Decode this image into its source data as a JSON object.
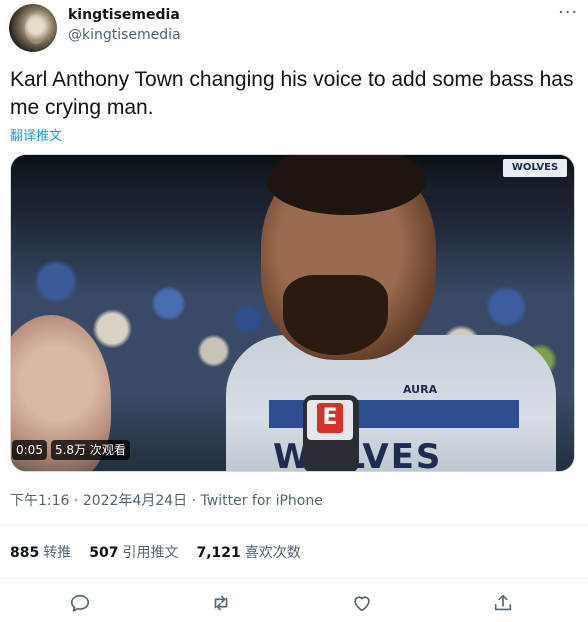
{
  "user": {
    "display_name": "kingtisemedia",
    "handle": "@kingtisemedia"
  },
  "more_label": "···",
  "tweet": {
    "text": "Karl Anthony Town changing his voice to add some bass has me crying man.",
    "translate_label": "翻译推文"
  },
  "media": {
    "duration": "0:05",
    "views": "5.8万 次观看",
    "sign_text": "WOLVES",
    "jersey_text": "WOLVES",
    "jersey_brand": "AURA",
    "mic_logo": "E"
  },
  "meta": {
    "time": "下午1:16",
    "separator": " · ",
    "date": "2022年4月24日",
    "source": "Twitter for iPhone"
  },
  "stats": {
    "retweets_count": "885",
    "retweets_label": "转推",
    "quotes_count": "507",
    "quotes_label": "引用推文",
    "likes_count": "7,121",
    "likes_label": "喜欢次数"
  },
  "icons": [
    "reply-icon",
    "retweet-icon",
    "like-icon",
    "share-icon"
  ],
  "colors": {
    "accent": "#1d9bf0",
    "muted": "#536471",
    "text": "#0f1419"
  }
}
